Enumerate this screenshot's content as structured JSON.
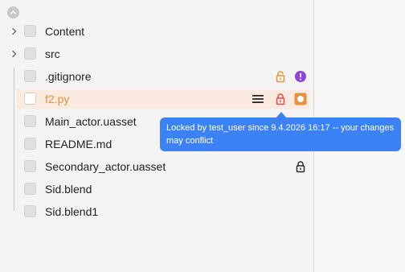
{
  "tree": {
    "items": [
      {
        "label": "Content"
      },
      {
        "label": "src"
      },
      {
        "label": ".gitignore"
      },
      {
        "label": "f2.py"
      },
      {
        "label": "Main_actor.uasset"
      },
      {
        "label": "README.md"
      },
      {
        "label": "Secondary_actor.uasset"
      },
      {
        "label": "Sid.blend"
      },
      {
        "label": "Sid.blend1"
      }
    ]
  },
  "tooltip": {
    "text": "Locked by test_user since 9.4.2026 16:17 -- your changes may conflict"
  },
  "colors": {
    "accent_orange": "#e8913d",
    "lock_red": "#e5484d",
    "status_purple": "#8e44d8",
    "tooltip_blue": "#3b82f6",
    "highlight_row": "#fbeadf"
  },
  "icons": {
    "collapse": "chevron-up-icon",
    "expand": "chevron-right-icon",
    "lock_orange": "lock-icon",
    "lock_red": "lock-icon",
    "lock_dark": "lock-icon",
    "menu": "hamburger-menu-icon",
    "conflict": "exclamation-icon",
    "modified": "modified-status-icon"
  }
}
